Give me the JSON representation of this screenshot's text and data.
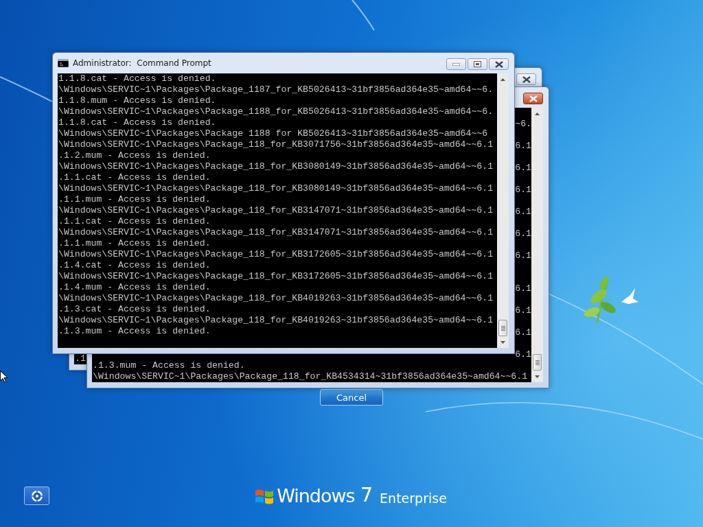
{
  "windows": [
    {
      "kind": "console",
      "active": false,
      "lines": [
        {
          "kind": "line",
          "text": ".1"
        }
      ]
    },
    {
      "kind": "console",
      "active": true,
      "lines": [
        {
          "kind": "gap"
        },
        {
          "kind": "tail",
          "text": "~6."
        },
        {
          "kind": "gap"
        },
        {
          "kind": "tail",
          "text": "6.1"
        },
        {
          "kind": "gap"
        },
        {
          "kind": "tail",
          "text": "6.1"
        },
        {
          "kind": "gap"
        },
        {
          "kind": "tail",
          "text": "6.1"
        },
        {
          "kind": "gap"
        },
        {
          "kind": "tail",
          "text": "6.1"
        },
        {
          "kind": "gap"
        },
        {
          "kind": "tail",
          "text": "6.1"
        },
        {
          "kind": "gap"
        },
        {
          "kind": "tail",
          "text": "6.1"
        },
        {
          "kind": "gap"
        },
        {
          "kind": "gap"
        },
        {
          "kind": "tail",
          "text": "6.1"
        },
        {
          "kind": "gap"
        },
        {
          "kind": "tail",
          "text": "6.1"
        },
        {
          "kind": "gap"
        },
        {
          "kind": "tail",
          "text": "6.1"
        },
        {
          "kind": "gap"
        },
        {
          "kind": "tail",
          "text": "6.1"
        },
        {
          "kind": "line",
          "text": ".1.3.mum - Access is denied."
        },
        {
          "kind": "line",
          "text": "\\Windows\\SERVIC~1\\Packages\\Package_118_for_KB4534314~31bf3856ad364e35~amd64~~6.1"
        }
      ]
    },
    {
      "kind": "console",
      "active": false,
      "title": "Administrator:  Command Prompt",
      "lines": [
        {
          "kind": "line",
          "text": "1.1.8.cat - Access is denied."
        },
        {
          "kind": "line",
          "text": "\\Windows\\SERVIC~1\\Packages\\Package_1187_for_KB5026413~31bf3856ad364e35~amd64~~6."
        },
        {
          "kind": "line",
          "text": "1.1.8.mum - Access is denied."
        },
        {
          "kind": "line",
          "text": "\\Windows\\SERVIC~1\\Packages\\Package_1188_for_KB5026413~31bf3856ad364e35~amd64~~6."
        },
        {
          "kind": "line",
          "text": "1.1.8.cat - Access is denied."
        },
        {
          "kind": "line",
          "text": "\\Windows\\SERVIC~1\\Packages\\Package 1188 for KB5026413~31bf3856ad364e35~amd64~~6"
        },
        {
          "kind": "line",
          "text": "\\Windows\\SERVIC~1\\Packages\\Package_118_for_KB3071756~31bf3856ad364e35~amd64~~6.1"
        },
        {
          "kind": "line",
          "text": ".1.2.mum - Access is denied."
        },
        {
          "kind": "line",
          "text": "\\Windows\\SERVIC~1\\Packages\\Package_118_for_KB3080149~31bf3856ad364e35~amd64~~6.1"
        },
        {
          "kind": "line",
          "text": ".1.1.cat - Access is denied."
        },
        {
          "kind": "line",
          "text": "\\Windows\\SERVIC~1\\Packages\\Package_118_for_KB3080149~31bf3856ad364e35~amd64~~6.1"
        },
        {
          "kind": "line",
          "text": ".1.1.mum - Access is denied."
        },
        {
          "kind": "line",
          "text": "\\Windows\\SERVIC~1\\Packages\\Package_118_for_KB3147071~31bf3856ad364e35~amd64~~6.1"
        },
        {
          "kind": "line",
          "text": ".1.1.cat - Access is denied."
        },
        {
          "kind": "line",
          "text": "\\Windows\\SERVIC~1\\Packages\\Package_118_for_KB3147071~31bf3856ad364e35~amd64~~6.1"
        },
        {
          "kind": "line",
          "text": ".1.1.mum - Access is denied."
        },
        {
          "kind": "line",
          "text": "\\Windows\\SERVIC~1\\Packages\\Package_118_for_KB3172605~31bf3856ad364e35~amd64~~6.1"
        },
        {
          "kind": "line",
          "text": ".1.4.cat - Access is denied."
        },
        {
          "kind": "line",
          "text": "\\Windows\\SERVIC~1\\Packages\\Package_118_for_KB3172605~31bf3856ad364e35~amd64~~6.1"
        },
        {
          "kind": "line",
          "text": ".1.4.mum - Access is denied."
        },
        {
          "kind": "line",
          "text": "\\Windows\\SERVIC~1\\Packages\\Package_118_for_KB4019263~31bf3856ad364e35~amd64~~6.1"
        },
        {
          "kind": "line",
          "text": ".1.3.cat - Access is denied."
        },
        {
          "kind": "line",
          "text": "\\Windows\\SERVIC~1\\Packages\\Package_118_for_KB4019263~31bf3856ad364e35~amd64~~6.1"
        },
        {
          "kind": "line",
          "text": ".1.3.mum - Access is denied."
        }
      ]
    }
  ],
  "cancel_button": "Cancel",
  "logo": {
    "brand": "Windows",
    "version": "7",
    "edition": "Enterprise"
  }
}
